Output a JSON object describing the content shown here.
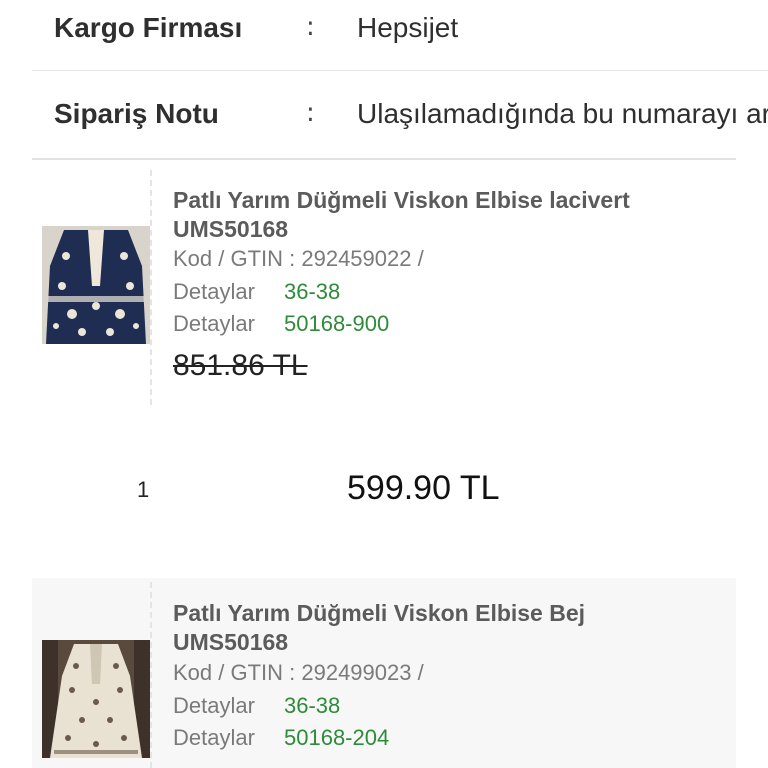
{
  "info": {
    "cargo": {
      "label": "Kargo Firması",
      "colon": ":",
      "value": "Hepsijet"
    },
    "note": {
      "label": "Sipariş Notu",
      "colon": ":",
      "value": "Ulaşılamadığında bu numarayı ara"
    }
  },
  "products": [
    {
      "title_line1": "Patlı Yarım Düğmeli Viskon Elbise lacivert",
      "title_line2": "UMS50168",
      "code": "Kod / GTIN : 292459022 /",
      "detail1_label": "Detaylar",
      "detail1_value": "36-38",
      "detail2_label": "Detaylar",
      "detail2_value": "50168-900",
      "old_price": "851.86 TL",
      "quantity": "1",
      "price": "599.90 TL",
      "thumb_color": "#1f2d52"
    },
    {
      "title_line1": "Patlı Yarım Düğmeli Viskon Elbise Bej",
      "title_line2": "UMS50168",
      "code": "Kod / GTIN : 292499023 /",
      "detail1_label": "Detaylar",
      "detail1_value": "36-38",
      "detail2_label": "Detaylar",
      "detail2_value": "50168-204",
      "thumb_color": "#e9e2d3"
    }
  ]
}
